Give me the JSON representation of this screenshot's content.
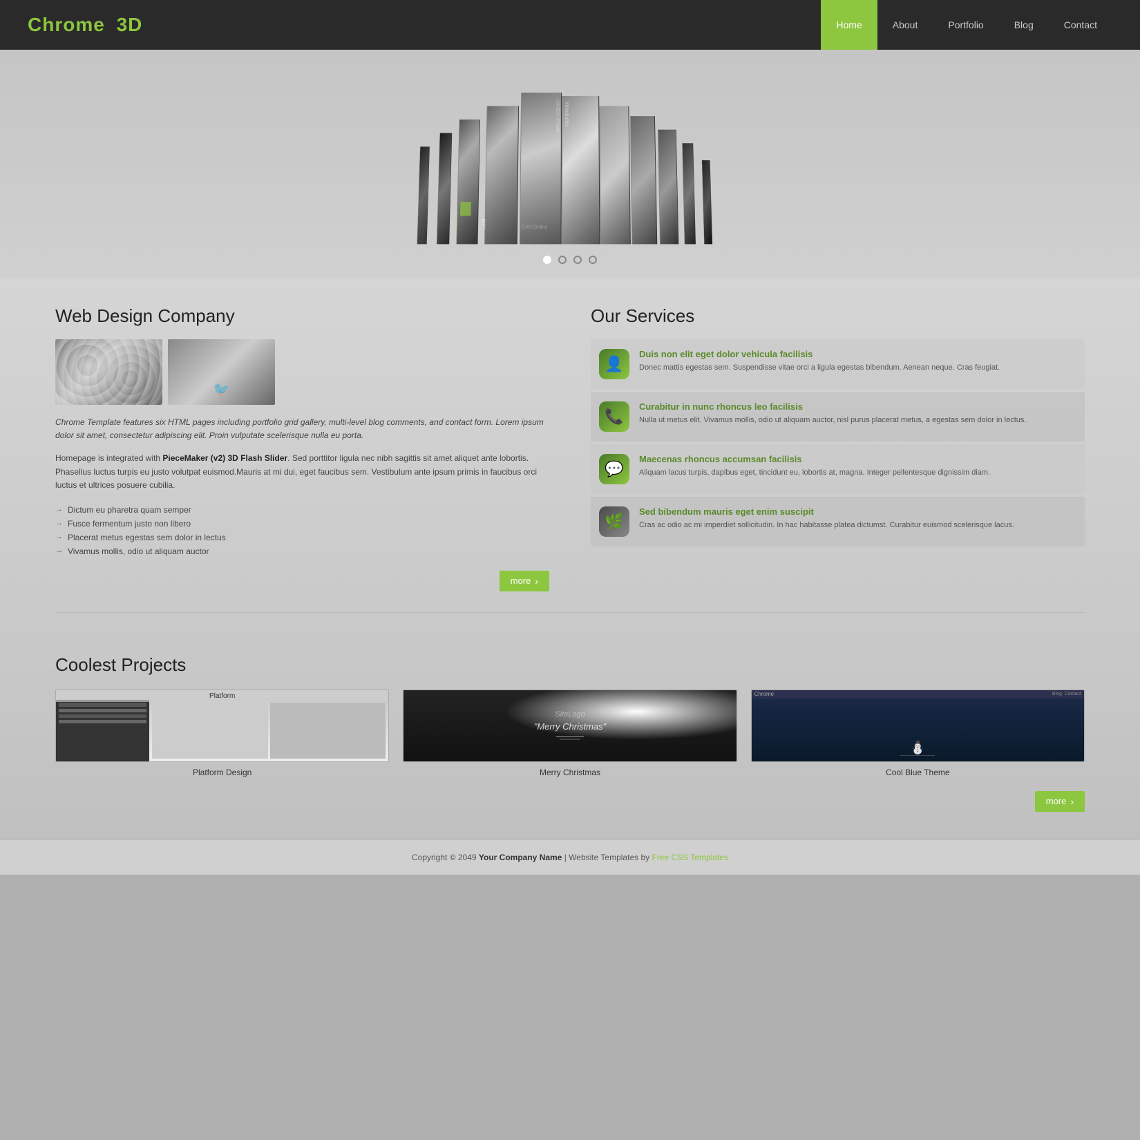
{
  "header": {
    "logo": "Chrome",
    "logo_accent": "3D",
    "nav": [
      {
        "label": "Home",
        "active": true
      },
      {
        "label": "About",
        "active": false
      },
      {
        "label": "Portfolio",
        "active": false
      },
      {
        "label": "Blog",
        "active": false
      },
      {
        "label": "Contact",
        "active": false
      }
    ]
  },
  "slider": {
    "dots": [
      {
        "active": true
      },
      {
        "active": false
      },
      {
        "active": false
      },
      {
        "active": false
      }
    ]
  },
  "left_col": {
    "heading": "Web Design Company",
    "desc_italic": "Chrome Template features six HTML pages including portfolio grid gallery, multi-level blog comments, and contact form. Lorem ipsum dolor sit amet, consectetur adipiscing elit. Proin vulputate scelerisque nulla eu porta.",
    "desc_normal_prefix": "Homepage is integrated with ",
    "desc_normal_brand": "PieceMaker (v2) 3D Flash Slider",
    "desc_normal_suffix": ". Sed porttitor ligula nec nibh sagittis sit amet aliquet ante lobortis. Phasellus luctus turpis eu justo volutpat euismod.Mauris at mi dui, eget faucibus sem. Vestibulum ante ipsum primis in faucibus orci luctus et ultrices posuere cubilia.",
    "bullets": [
      "Dictum eu pharetra quam semper",
      "Fusce fermentum justo non libero",
      "Placerat metus egestas sem dolor in lectus",
      "Vivamus mollis, odio ut aliquam auctor"
    ],
    "more_btn": "more"
  },
  "right_col": {
    "heading": "Our Services",
    "services": [
      {
        "icon": "👤",
        "icon_type": "contact",
        "title": "Duis non elit eget dolor vehicula facilisis",
        "desc": "Donec mattis egestas sem. Suspendisse vitae orci a ligula egestas bibendum. Aenean neque. Cras feugiat."
      },
      {
        "icon": "📞",
        "icon_type": "phone",
        "title": "Curabitur in nunc rhoncus leo facilisis",
        "desc": "Nulla ut metus elit. Vivamus mollis, odio ut aliquam auctor, nisl purus placerat metus, a egestas sem dolor in lectus."
      },
      {
        "icon": "💬",
        "icon_type": "chat",
        "title": "Maecenas rhoncus accumsan facilisis",
        "desc": "Aliquam lacus turpis, dapibus eget, tincidunt eu, lobortis at, magna. Integer pellentesque dignissim diam."
      },
      {
        "icon": "🌿",
        "icon_type": "photo",
        "title": "Sed bibendum mauris eget enim suscipit",
        "desc": "Cras ac odio ac mi imperdiet sollicitudin. In hac habitasse platea dictumst. Curabitur euismod scelerisque lacus."
      }
    ]
  },
  "projects": {
    "heading": "Coolest Projects",
    "items": [
      {
        "caption": "Platform Design",
        "type": "platform"
      },
      {
        "caption": "Merry Christmas",
        "type": "christmas"
      },
      {
        "caption": "Cool Blue Theme",
        "type": "blue-theme"
      }
    ],
    "more_btn": "more"
  },
  "footer": {
    "text": "Copyright © 2049",
    "company": "Your Company Name",
    "separator1": "|",
    "templates_text": "Website Templates",
    "by": "by",
    "link": "Free CSS Templates"
  }
}
